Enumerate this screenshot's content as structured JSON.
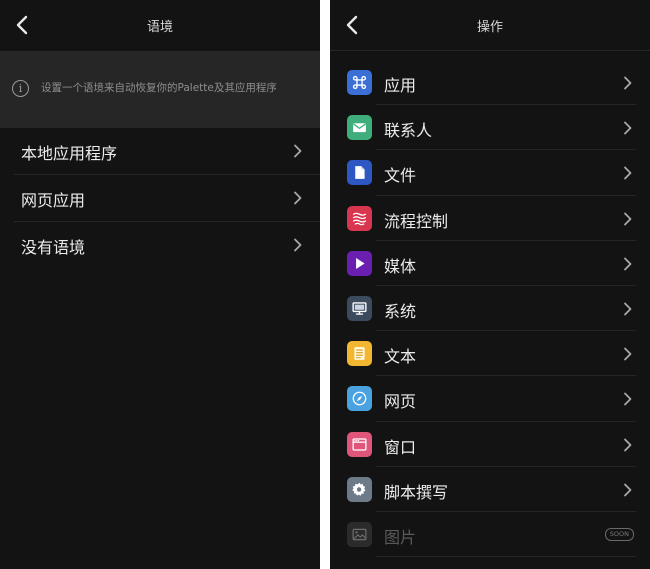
{
  "left": {
    "title": "语境",
    "info_text": "设置一个语境来自动恢复你的Palette及其应用程序",
    "items": [
      {
        "label": "本地应用程序"
      },
      {
        "label": "网页应用"
      },
      {
        "label": "没有语境"
      }
    ]
  },
  "right": {
    "title": "操作",
    "items": [
      {
        "label": "应用",
        "icon": "command-icon",
        "color": "#3b6fd6"
      },
      {
        "label": "联系人",
        "icon": "mail-icon",
        "color": "#3fae7c"
      },
      {
        "label": "文件",
        "icon": "file-icon",
        "color": "#2d58c4"
      },
      {
        "label": "流程控制",
        "icon": "flow-icon",
        "color": "#d8364e"
      },
      {
        "label": "媒体",
        "icon": "play-icon",
        "color": "#6a1fb0"
      },
      {
        "label": "系统",
        "icon": "monitor-icon",
        "color": "#3b4a5c"
      },
      {
        "label": "文本",
        "icon": "document-icon",
        "color": "#f2b632"
      },
      {
        "label": "网页",
        "icon": "compass-icon",
        "color": "#4aa3e0"
      },
      {
        "label": "窗口",
        "icon": "window-icon",
        "color": "#e0567a"
      },
      {
        "label": "脚本撰写",
        "icon": "gear-icon",
        "color": "#6d7a88"
      },
      {
        "label": "图片",
        "icon": "image-icon",
        "color": "#4a4a4a",
        "badge": "SOON"
      }
    ]
  }
}
